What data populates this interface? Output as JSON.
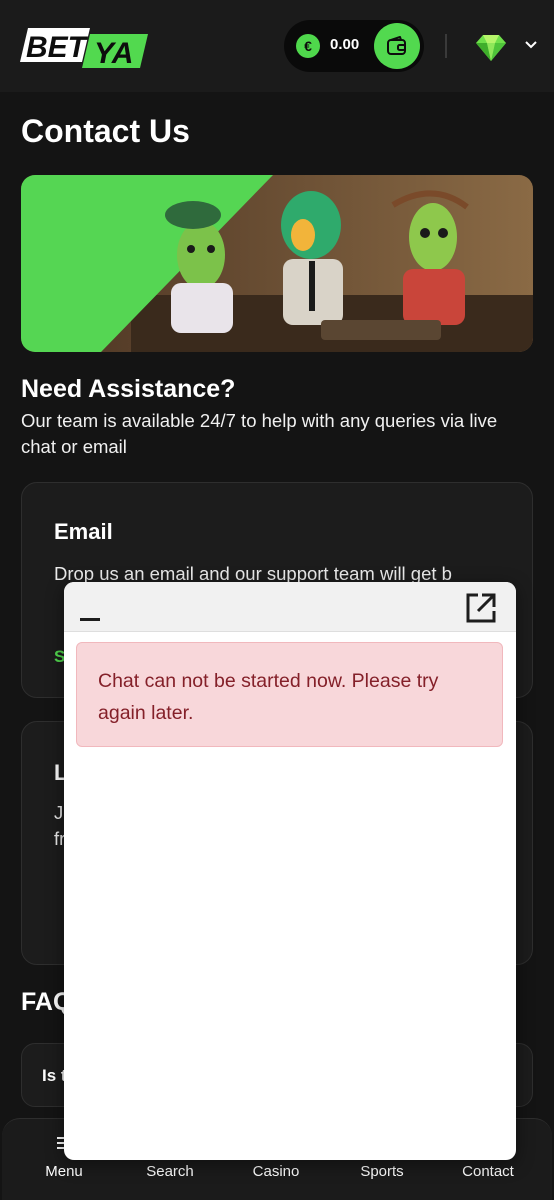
{
  "header": {
    "logo_text_left": "BET",
    "logo_text_right": "YA",
    "currency_symbol": "€",
    "balance": "0.00",
    "wallet_icon": "wallet-icon",
    "vip_icon": "diamond-icon",
    "menu_icon": "chevron-down-icon"
  },
  "page": {
    "title": "Contact Us",
    "assist_title": "Need Assistance?",
    "assist_text": "Our team is available 24/7 to help with any queries via live chat or email"
  },
  "cards": {
    "email": {
      "title": "Email",
      "text": "Drop us an email and our support team will get b",
      "link": "S"
    },
    "live": {
      "title": "L",
      "text_line1": "J",
      "text_line2": "fr"
    }
  },
  "faq": {
    "title": "FAQ",
    "first_item": "Is t"
  },
  "bottom_nav": {
    "items": [
      "Menu",
      "Search",
      "Casino",
      "Sports",
      "Contact"
    ]
  },
  "chat": {
    "minimize_icon": "minimize-icon",
    "popout_icon": "open-in-new-icon",
    "alert_text": "Chat can not be started now. Please try again later."
  },
  "colors": {
    "accent": "#52d94f",
    "background": "#141414",
    "card": "#1c1c1c",
    "alert_bg": "#f8d7da",
    "alert_text": "#842029"
  }
}
